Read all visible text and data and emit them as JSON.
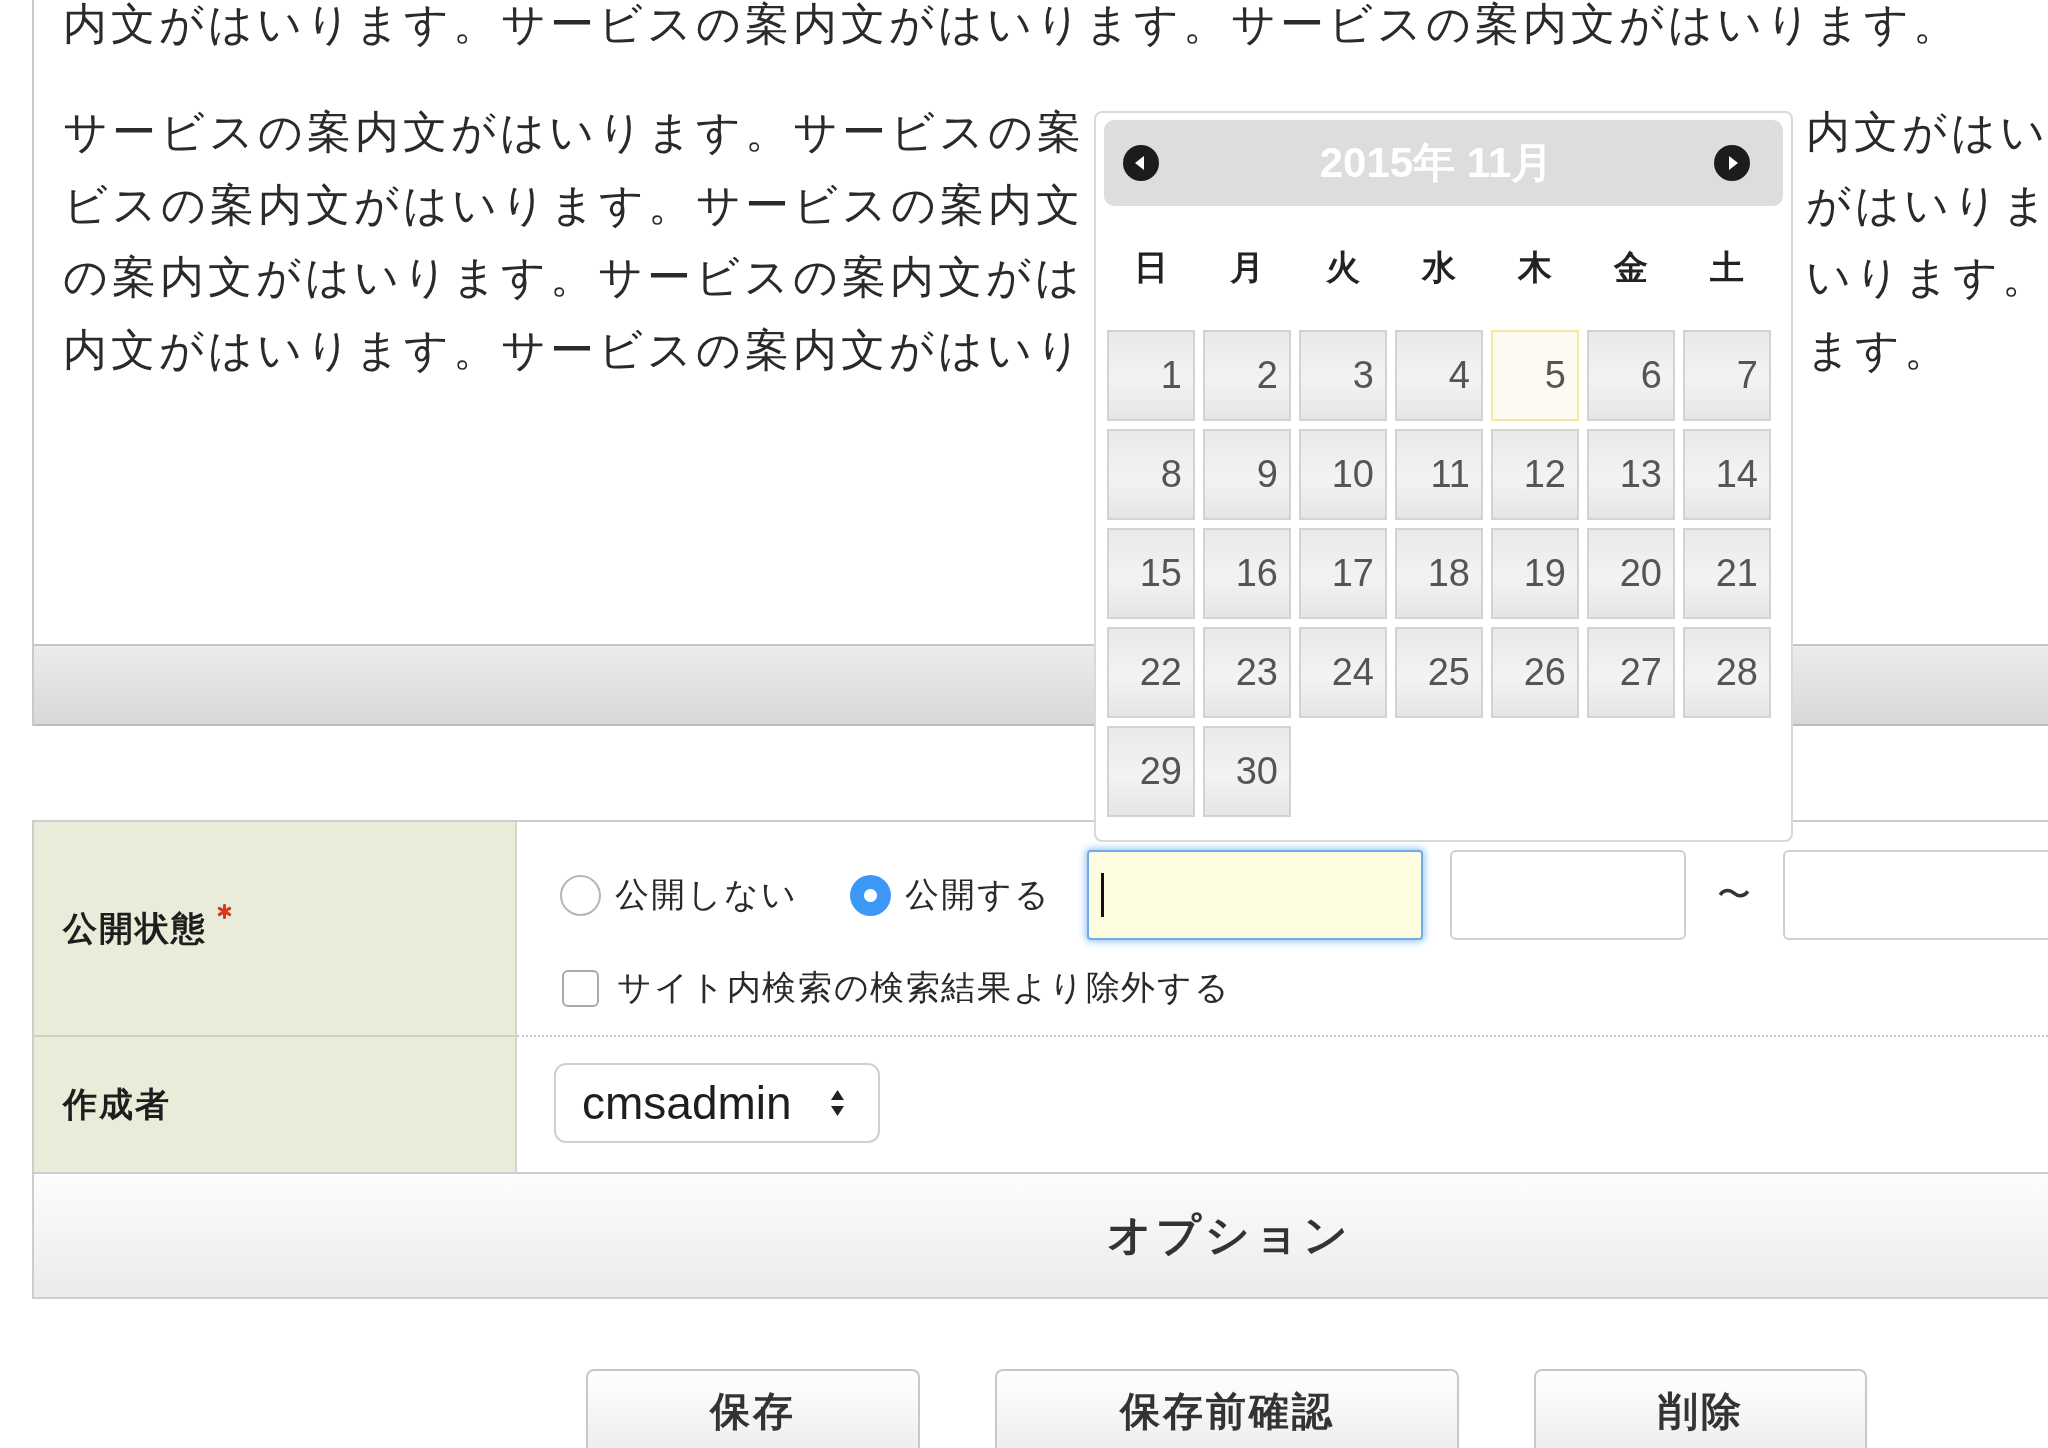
{
  "editor": {
    "paragraphs": [
      {
        "lines": [
          {
            "segments": [
              "内文がはいります。サービスの案内文がはいります。サービスの案内文がはいります。"
            ]
          }
        ]
      },
      {
        "lines": [
          {
            "segments": [
              "サービスの案内文がはいります。サービスの案",
              "内文がはい"
            ]
          },
          {
            "segments": [
              "ビスの案内文がはいります。サービスの案内文",
              "がはいりま"
            ]
          },
          {
            "segments": [
              "の案内文がはいります。サービスの案内文がは",
              "いります。"
            ]
          },
          {
            "segments": [
              "内文がはいります。サービスの案内文がはいり",
              "ます。"
            ]
          }
        ]
      }
    ]
  },
  "datepicker": {
    "title": "2015年 11月",
    "weekdays": [
      "日",
      "月",
      "火",
      "水",
      "木",
      "金",
      "土"
    ],
    "days": [
      {
        "label": "1",
        "today": false
      },
      {
        "label": "2",
        "today": false
      },
      {
        "label": "3",
        "today": false
      },
      {
        "label": "4",
        "today": false
      },
      {
        "label": "5",
        "today": true
      },
      {
        "label": "6",
        "today": false
      },
      {
        "label": "7",
        "today": false
      },
      {
        "label": "8",
        "today": false
      },
      {
        "label": "9",
        "today": false
      },
      {
        "label": "10",
        "today": false
      },
      {
        "label": "11",
        "today": false
      },
      {
        "label": "12",
        "today": false
      },
      {
        "label": "13",
        "today": false
      },
      {
        "label": "14",
        "today": false
      },
      {
        "label": "15",
        "today": false
      },
      {
        "label": "16",
        "today": false
      },
      {
        "label": "17",
        "today": false
      },
      {
        "label": "18",
        "today": false
      },
      {
        "label": "19",
        "today": false
      },
      {
        "label": "20",
        "today": false
      },
      {
        "label": "21",
        "today": false
      },
      {
        "label": "22",
        "today": false
      },
      {
        "label": "23",
        "today": false
      },
      {
        "label": "24",
        "today": false
      },
      {
        "label": "25",
        "today": false
      },
      {
        "label": "26",
        "today": false
      },
      {
        "label": "27",
        "today": false
      },
      {
        "label": "28",
        "today": false
      },
      {
        "label": "29",
        "today": false
      },
      {
        "label": "30",
        "today": false
      }
    ]
  },
  "form": {
    "rows": [
      {
        "kind": "status",
        "label": "公開状態",
        "required": true,
        "radios": [
          {
            "label": "公開しない",
            "selected": false
          },
          {
            "label": "公開する",
            "selected": true
          }
        ],
        "period": {
          "start_fields": [
            {
              "focused": true
            },
            {
              "focused": false
            }
          ],
          "separator": "〜",
          "end_fields": [
            {
              "focused": false
            }
          ]
        },
        "checkbox": {
          "label": "サイト内検索の検索結果より除外する",
          "checked": false
        }
      },
      {
        "kind": "select",
        "label": "作成者",
        "required": false,
        "value": "cmsadmin"
      }
    ]
  },
  "options_header": {
    "title": "オプション"
  },
  "buttons": [
    {
      "label": "保存"
    },
    {
      "label": "保存前確認"
    },
    {
      "label": "削除"
    }
  ]
}
